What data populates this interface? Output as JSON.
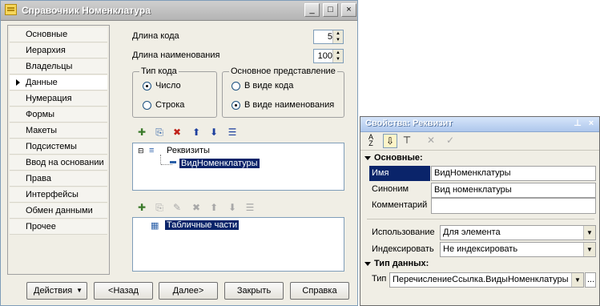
{
  "window": {
    "title": "Справочник Номенклатура",
    "minimize": "_",
    "maximize": "□",
    "close": "×"
  },
  "nav": {
    "items": [
      "Основные",
      "Иерархия",
      "Владельцы",
      "Данные",
      "Нумерация",
      "Формы",
      "Макеты",
      "Подсистемы",
      "Ввод на основании",
      "Права",
      "Интерфейсы",
      "Обмен данными",
      "Прочее"
    ],
    "active": "Данные"
  },
  "data_tab": {
    "code_length_label": "Длина кода",
    "code_length_value": "5",
    "name_length_label": "Длина наименования",
    "name_length_value": "100",
    "code_type": {
      "legend": "Тип кода",
      "options": [
        "Число",
        "Строка"
      ],
      "selected": "Число"
    },
    "main_repr": {
      "legend": "Основное представление",
      "options": [
        "В виде кода",
        "В виде наименования"
      ],
      "selected": "В виде наименования"
    },
    "attributes_tree": {
      "root": "Реквизиты",
      "child": "ВидНоменклатуры"
    },
    "tabular_tree": {
      "root": "Табличные части"
    }
  },
  "footer": {
    "actions": "Действия",
    "back": "<Назад",
    "next": "Далее>",
    "close": "Закрыть",
    "help": "Справка"
  },
  "props": {
    "title": "Свойства: Реквизит",
    "pin": "⊥",
    "close": "×",
    "section_main": "Основные:",
    "name_label": "Имя",
    "name_value": "ВидНоменклатуры",
    "synonym_label": "Синоним",
    "synonym_value": "Вид номенклатуры",
    "comment_label": "Комментарий",
    "comment_value": "",
    "usage_label": "Использование",
    "usage_value": "Для элемента",
    "index_label": "Индексировать",
    "index_value": "Не индексировать",
    "section_type": "Тип данных:",
    "type_label": "Тип",
    "type_value": "ПеречислениеСсылка.ВидыНоменклатуры",
    "more": "..."
  }
}
